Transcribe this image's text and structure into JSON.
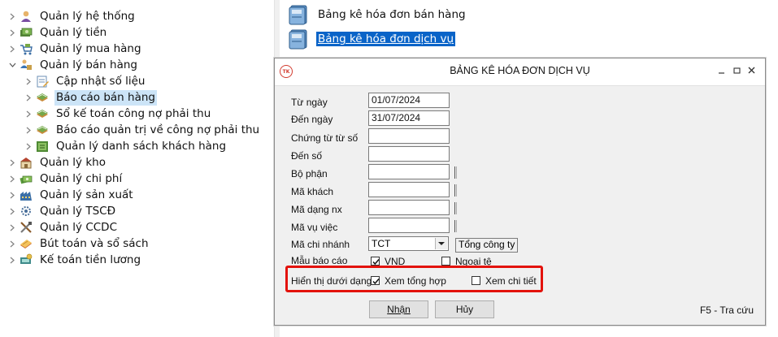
{
  "tree": {
    "items": [
      {
        "label": "Quản lý hệ thống",
        "icon": "system-user-icon",
        "expanded": false
      },
      {
        "label": "Quản lý tiền",
        "icon": "money-icon",
        "expanded": false
      },
      {
        "label": "Quản lý mua hàng",
        "icon": "purchase-icon",
        "expanded": false
      },
      {
        "label": "Quản lý bán hàng",
        "icon": "sales-icon",
        "expanded": true
      },
      {
        "label": "Cập nhật số liệu",
        "icon": "update-data-icon",
        "child": true
      },
      {
        "label": "Báo cáo bán hàng",
        "icon": "book-report-icon",
        "child": true,
        "selected": true
      },
      {
        "label": "Sổ kế toán công nợ phải thu",
        "icon": "book-report-icon",
        "child": true
      },
      {
        "label": "Báo cáo quản trị về công nợ phải thu",
        "icon": "book-report-icon",
        "child": true
      },
      {
        "label": "Quản lý danh sách khách hàng",
        "icon": "customer-list-icon",
        "child": true
      },
      {
        "label": "Quản lý kho",
        "icon": "warehouse-icon",
        "expanded": false
      },
      {
        "label": "Quản lý chi phí",
        "icon": "expense-icon",
        "expanded": false
      },
      {
        "label": "Quản lý sản xuất",
        "icon": "factory-icon",
        "expanded": false
      },
      {
        "label": "Quản lý TSCĐ",
        "icon": "fixed-asset-icon",
        "expanded": false
      },
      {
        "label": "Quản lý CCDC",
        "icon": "tools-icon",
        "expanded": false
      },
      {
        "label": "Bút toán và sổ sách",
        "icon": "ledger-icon",
        "expanded": false
      },
      {
        "label": "Kế toán tiền lương",
        "icon": "payroll-icon",
        "expanded": false
      }
    ]
  },
  "reports": [
    {
      "label": "Bảng kê hóa đơn bán hàng",
      "icon": "report-book-icon"
    },
    {
      "label": "Bảng kê hóa đơn dịch vụ",
      "icon": "report-book-icon",
      "selected": true
    }
  ],
  "dialog": {
    "logo": "TK",
    "title": "BẢNG KÊ HÓA ĐƠN DỊCH VỤ",
    "fields": {
      "from_date": {
        "label": "Từ ngày",
        "value": "01/07/2024"
      },
      "to_date": {
        "label": "Đến ngày",
        "value": "31/07/2024"
      },
      "from_doc": {
        "label": "Chứng từ từ số",
        "value": ""
      },
      "to_doc": {
        "label": "Đến số",
        "value": ""
      },
      "department": {
        "label": "Bộ phận",
        "value": ""
      },
      "customer": {
        "label": "Mã khách",
        "value": ""
      },
      "nx_type": {
        "label": "Mã dạng nx",
        "value": ""
      },
      "job": {
        "label": "Mã vụ việc",
        "value": ""
      },
      "branch": {
        "label": "Mã chi nhánh",
        "value": "TCT",
        "name": "Tổng công ty"
      }
    },
    "template": {
      "label": "Mẫu báo cáo",
      "vnd": "VND",
      "vnd_checked": true,
      "foreign": "Ngoại tệ",
      "foreign_checked": false
    },
    "display": {
      "label": "Hiển thị dưới dạng",
      "summary": "Xem tổng hợp",
      "summary_checked": true,
      "detail": "Xem chi tiết",
      "detail_checked": false
    },
    "buttons": {
      "ok": "Nhận",
      "cancel": "Hủy"
    },
    "hint": "F5 - Tra cứu",
    "highlight_color": "#e3120b"
  }
}
